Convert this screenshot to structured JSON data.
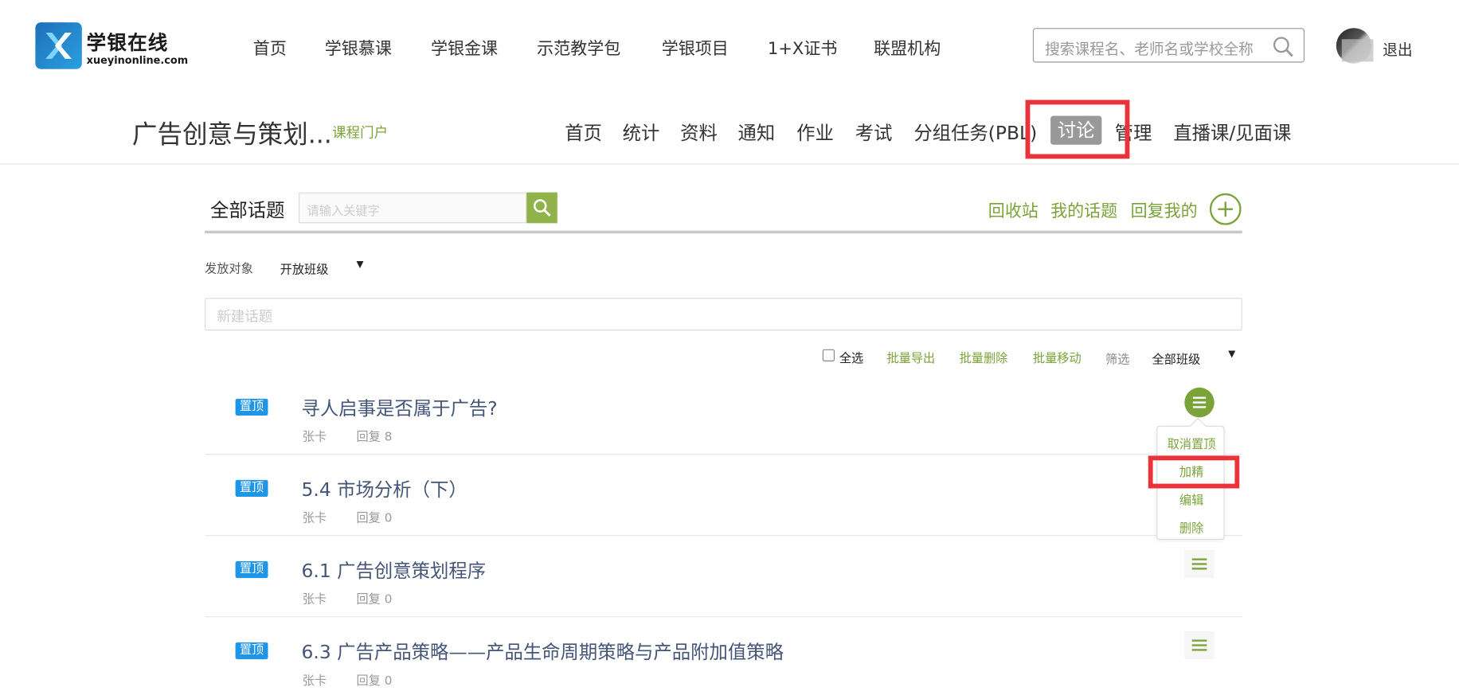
{
  "brand": {
    "name_cn": "学银在线",
    "name_en": "xueyinonline.com"
  },
  "top_nav": [
    "首页",
    "学银慕课",
    "学银金课",
    "示范教学包",
    "学银项目",
    "1+X证书",
    "联盟机构"
  ],
  "search": {
    "placeholder": "搜索课程名、老师名或学校全称"
  },
  "user": {
    "logout_label": "退出"
  },
  "course": {
    "title": "广告创意与策划...",
    "portal_label": "课程门户",
    "nav": [
      "首页",
      "统计",
      "资料",
      "通知",
      "作业",
      "考试",
      "分组任务(PBL)",
      "讨论",
      "管理",
      "直播课/见面课"
    ],
    "active_tab": "讨论"
  },
  "topics": {
    "heading": "全部话题",
    "keyword_placeholder": "请输入关键字",
    "links": [
      "回收站",
      "我的话题",
      "回复我的"
    ],
    "target_label": "发放对象",
    "target_value": "开放班级",
    "new_topic_placeholder": "新建话题",
    "select_all": "全选",
    "batch_actions": [
      "批量导出",
      "批量删除",
      "批量移动"
    ],
    "filter_label": "筛选",
    "filter_value": "全部班级",
    "dropdown_arrow": "▼",
    "pin_label": "置顶",
    "items": [
      {
        "title": "寻人启事是否属于广告?",
        "author": "张卡",
        "replies": "回复 8"
      },
      {
        "title": "5.4 市场分析（下）",
        "author": "张卡",
        "replies": "回复 0"
      },
      {
        "title": "6.1 广告创意策划程序",
        "author": "张卡",
        "replies": "回复 0"
      },
      {
        "title": "6.3 广告产品策略——产品生命周期策略与产品附加值策略",
        "author": "张卡",
        "replies": "回复 0"
      }
    ],
    "row_menu": [
      "取消置顶",
      "加精",
      "编辑",
      "删除"
    ]
  },
  "colors": {
    "accent_green": "#7aa33a",
    "pin_blue": "#1e95e6",
    "highlight_red": "#e8333a"
  }
}
